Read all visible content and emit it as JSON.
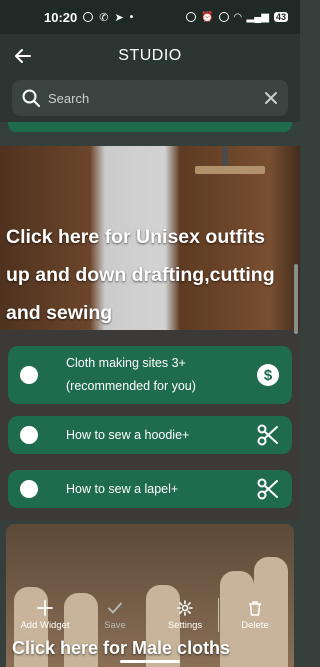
{
  "status_bar": {
    "time": "10:20",
    "battery": "43"
  },
  "header": {
    "title": "STUDIO"
  },
  "search": {
    "placeholder": "Search"
  },
  "banner_top": {
    "text": "Click here for Unisex outfits up and down drafting,cutting and sewing"
  },
  "list": [
    {
      "label_line1": "Cloth making sites 3+",
      "label_line2": "(recommended for you)",
      "icon": "dollar-icon"
    },
    {
      "label_line1": "How to sew a hoodie+",
      "icon": "scissors-icon"
    },
    {
      "label_line1": "How to sew a lapel+",
      "icon": "scissors-icon"
    }
  ],
  "banner_bottom": {
    "text": "Click here for Male cloths"
  },
  "toolbar": {
    "add_widget": "Add Widget",
    "save": "Save",
    "settings": "Settings",
    "delete": "Delete"
  },
  "colors": {
    "accent": "#1f6b4e",
    "background": "#35403d",
    "header": "#2b3532"
  }
}
